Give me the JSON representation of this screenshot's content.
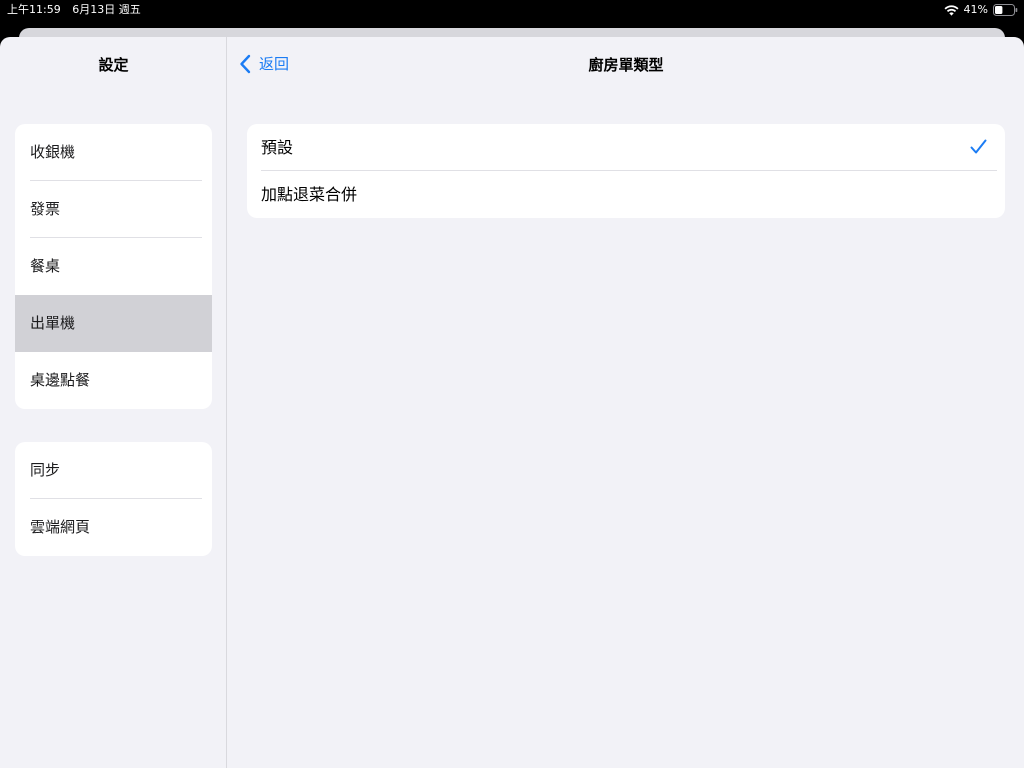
{
  "status_bar": {
    "time": "上午11:59",
    "date": "6月13日 週五",
    "battery": "41%",
    "icons": [
      "wifi-icon",
      "battery-icon"
    ]
  },
  "sidebar": {
    "title": "設定",
    "groups": [
      {
        "items": [
          {
            "label": "收銀機",
            "selected": false
          },
          {
            "label": "發票",
            "selected": false
          },
          {
            "label": "餐桌",
            "selected": false
          },
          {
            "label": "出單機",
            "selected": true
          },
          {
            "label": "桌邊點餐",
            "selected": false
          }
        ]
      },
      {
        "items": [
          {
            "label": "同步",
            "selected": false
          },
          {
            "label": "雲端網頁",
            "selected": false
          }
        ]
      }
    ]
  },
  "detail": {
    "back_label": "返回",
    "title": "廚房單類型",
    "options": [
      {
        "label": "預設",
        "checked": true
      },
      {
        "label": "加點退菜合併",
        "checked": false
      }
    ]
  },
  "colors": {
    "accent": "#1b7cf4",
    "background": "#f2f2f7",
    "selected_row": "#d1d1d6"
  }
}
